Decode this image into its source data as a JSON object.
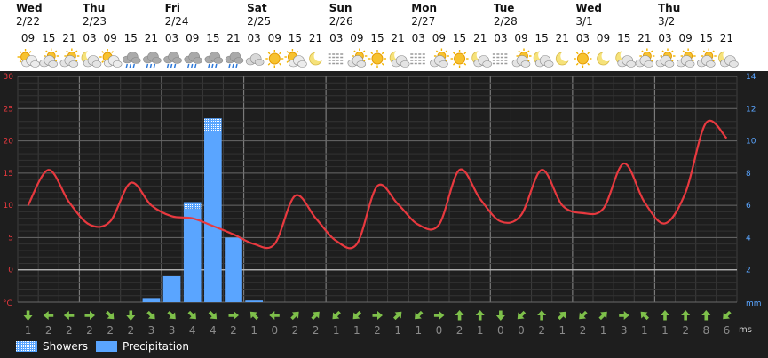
{
  "chart_data": {
    "type": "line+bar",
    "days": [
      {
        "name": "Wed",
        "date": "2/22"
      },
      {
        "name": "Thu",
        "date": "2/23"
      },
      {
        "name": "Fri",
        "date": "2/24"
      },
      {
        "name": "Sat",
        "date": "2/25"
      },
      {
        "name": "Sun",
        "date": "2/26"
      },
      {
        "name": "Mon",
        "date": "2/27"
      },
      {
        "name": "Tue",
        "date": "2/28"
      },
      {
        "name": "Wed",
        "date": "3/1"
      },
      {
        "name": "Thu",
        "date": "3/2"
      }
    ],
    "hours": [
      "09",
      "15",
      "21",
      "03",
      "09",
      "15",
      "21",
      "03",
      "09",
      "15",
      "21",
      "03",
      "09",
      "15",
      "21",
      "03",
      "09",
      "15",
      "21",
      "03",
      "09",
      "15",
      "21",
      "03",
      "09",
      "15",
      "21",
      "03",
      "09",
      "15",
      "21",
      "03",
      "09",
      "15",
      "21"
    ],
    "weather_icons": [
      "sun-cloud",
      "cloud-sun",
      "cloud-sun",
      "moon-cloud",
      "sun-cloud",
      "cloud-rain",
      "cloud-rain",
      "cloud-rain",
      "cloud-rain",
      "cloud-rain",
      "cloud-rain",
      "cloud",
      "sun",
      "sun-cloud",
      "moon",
      "fog",
      "cloud-sun",
      "sun",
      "cloud-moon",
      "fog",
      "cloud-sun",
      "sun",
      "cloud-moon",
      "fog",
      "cloud-sun",
      "cloud-moon",
      "moon",
      "sun",
      "moon",
      "cloud-moon",
      "cloud-sun",
      "cloud-sun",
      "cloud-sun",
      "cloud-sun",
      "cloud-moon"
    ],
    "temperature": {
      "unit": "°C",
      "ylim": [
        -5,
        30
      ],
      "ticks": [
        30,
        25,
        20,
        15,
        10,
        5,
        0
      ],
      "color": "#e8393f",
      "values": [
        10,
        15.5,
        10.5,
        7,
        7.5,
        13.5,
        10,
        8.3,
        8,
        6.8,
        5.5,
        4,
        4,
        11.5,
        8,
        4.5,
        4,
        13,
        10.2,
        7,
        7,
        15.5,
        11,
        7.5,
        8.5,
        15.5,
        10,
        8.8,
        9.5,
        16.5,
        10.5,
        7.2,
        12,
        22.8,
        20.4
      ]
    },
    "precipitation": {
      "unit": "mm",
      "ylim": [
        0,
        14
      ],
      "ticks": [
        14,
        12,
        10,
        8,
        6,
        4,
        2
      ],
      "color": "#5aa5ff",
      "values": [
        0,
        0,
        0,
        0,
        0,
        0,
        0.2,
        1.6,
        5.8,
        10.6,
        4.0,
        0.1,
        0,
        0,
        0,
        0,
        0,
        0,
        0,
        0,
        0,
        0,
        0,
        0,
        0,
        0,
        0,
        0,
        0,
        0,
        0,
        0,
        0,
        0,
        0
      ],
      "showers": [
        0,
        0,
        0,
        0,
        0,
        0,
        0,
        0,
        0.4,
        0.8,
        0,
        0,
        0,
        0,
        0,
        0,
        0,
        0,
        0,
        0,
        0,
        0,
        0,
        0,
        0,
        0,
        0,
        0,
        0,
        0,
        0,
        0,
        0,
        0,
        0
      ]
    },
    "wind": {
      "unit": "ms",
      "directions": [
        "S",
        "W",
        "W",
        "E",
        "SE",
        "S",
        "SE",
        "SE",
        "SE",
        "SE",
        "E",
        "NW",
        "W",
        "NE",
        "NE",
        "SW",
        "SW",
        "E",
        "NE",
        "SW",
        "E",
        "N",
        "N",
        "S",
        "SW",
        "N",
        "NE",
        "SW",
        "NE",
        "E",
        "NW",
        "N",
        "N",
        "N",
        "SW"
      ],
      "speeds": [
        "1",
        "2",
        "2",
        "2",
        "2",
        "2",
        "3",
        "3",
        "4",
        "4",
        "2",
        "1",
        "0",
        "2",
        "2",
        "1",
        "1",
        "2",
        "1",
        "1",
        "0",
        "2",
        "1",
        "0",
        "0",
        "2",
        "1",
        "2",
        "1",
        "3",
        "1",
        "1",
        "2",
        "8",
        "6",
        "6"
      ]
    },
    "legend": [
      {
        "label": "Showers",
        "pattern": "dots"
      },
      {
        "label": "Precipitation",
        "color": "#5aa5ff"
      }
    ],
    "grid": true
  }
}
